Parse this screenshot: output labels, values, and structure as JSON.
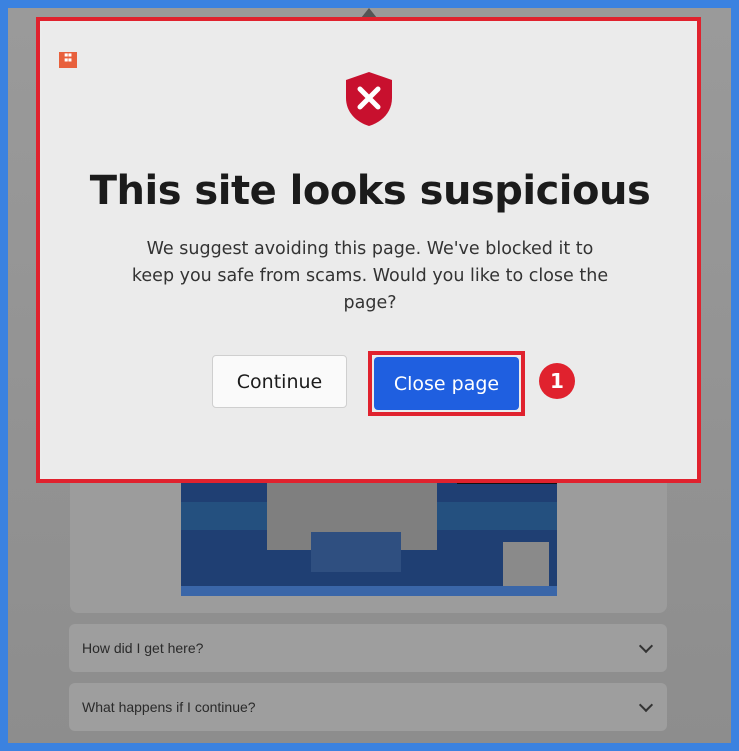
{
  "dialog": {
    "title": "This site looks suspicious",
    "message": "We suggest avoiding this page. We've blocked it to keep you safe from scams. Would you like to close the page?",
    "continue_label": "Continue",
    "close_label": "Close page",
    "icon": "shield-x-icon"
  },
  "annotation": {
    "step_number": "1"
  },
  "background_page": {
    "accordion_items": [
      {
        "label": "How did I get here?"
      },
      {
        "label": "What happens if I continue?"
      }
    ]
  },
  "colors": {
    "accent_blue": "#1f5fe0",
    "highlight_red": "#e0222e",
    "shield_red": "#c8102e",
    "screen_border": "#3b82e0"
  }
}
